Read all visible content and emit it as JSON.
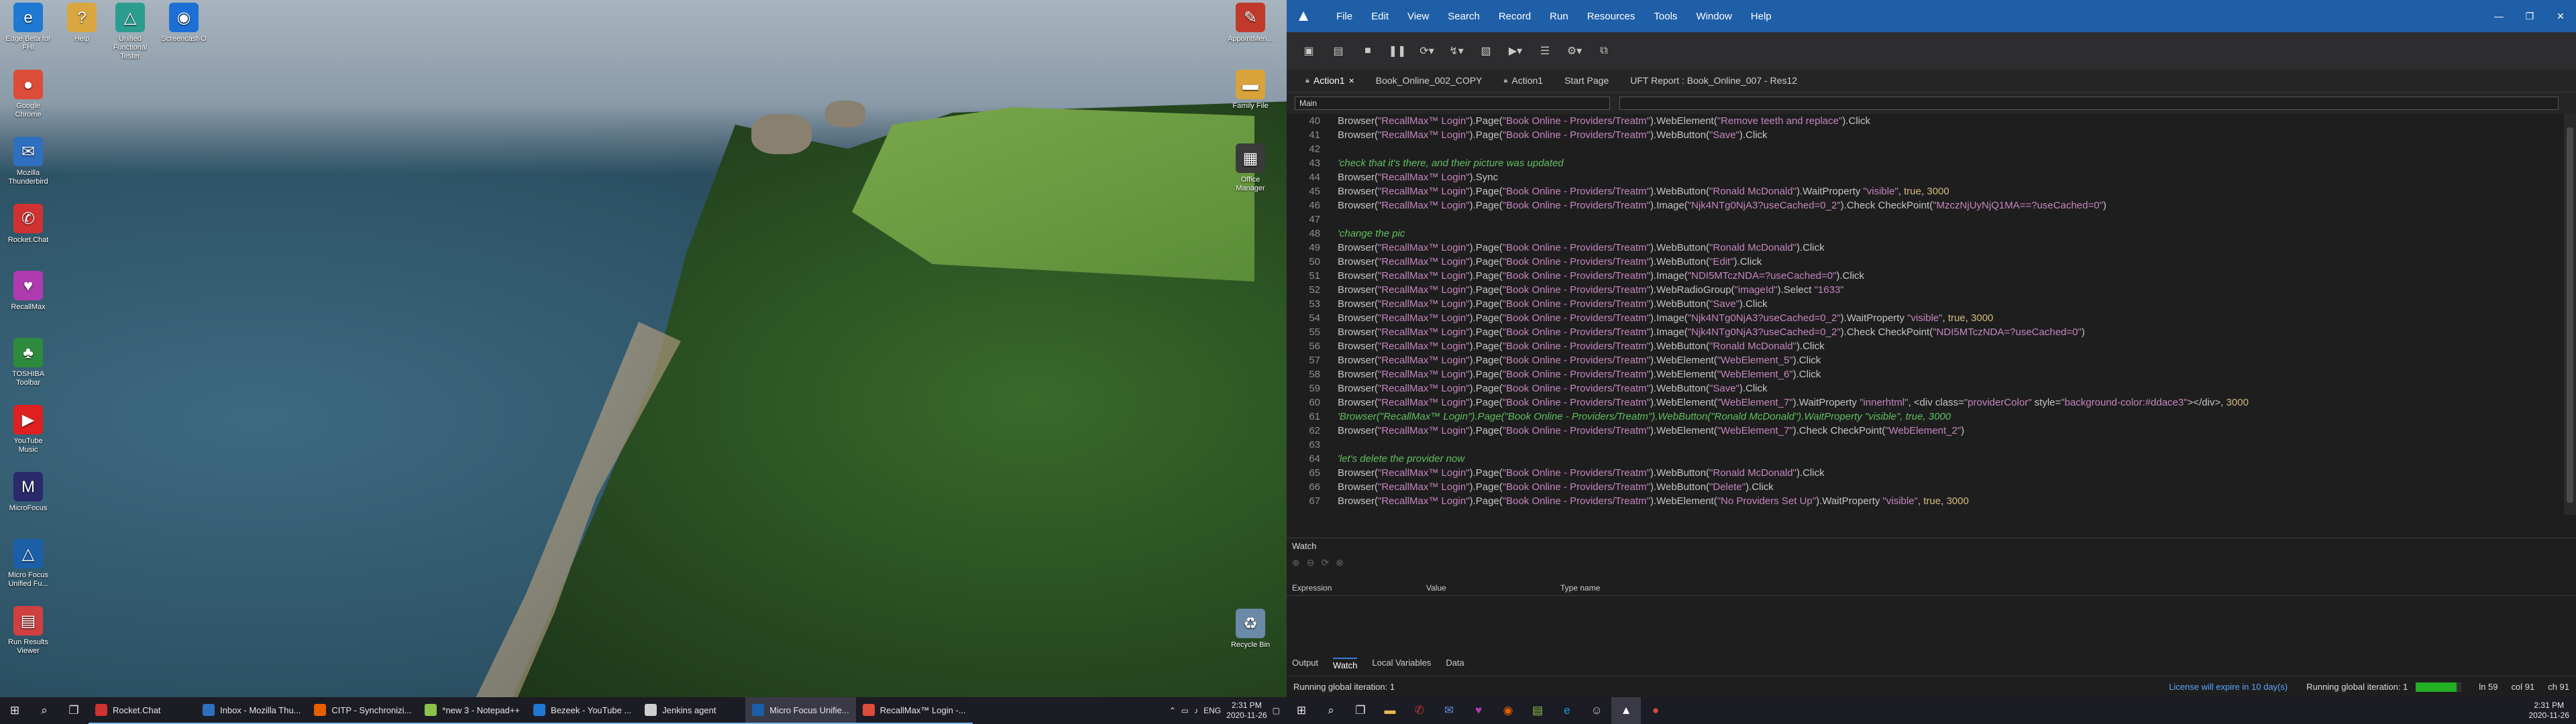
{
  "desktop": {
    "icons_left": [
      {
        "label": "Edge Beta for FHI",
        "color": "#1f78d1",
        "glyph": "e"
      },
      {
        "label": "Help",
        "color": "#d9a640",
        "glyph": "?"
      },
      {
        "label": "Unified Functional Tester",
        "color": "#2a9d8f",
        "glyph": "△"
      },
      {
        "label": "Screencast-O",
        "color": "#1d6fd6",
        "glyph": "◉"
      },
      {
        "label": "Google Chrome",
        "color": "#dd4b39",
        "glyph": "●"
      },
      {
        "label": "Mozilla Thunderbird",
        "color": "#2f6fbf",
        "glyph": "✉"
      },
      {
        "label": "Rocket.Chat",
        "color": "#d03232",
        "glyph": "✆"
      },
      {
        "label": "RecallMax",
        "color": "#b03ab0",
        "glyph": "♥"
      },
      {
        "label": "TOSHIBA Toolbar",
        "color": "#2e8b3e",
        "glyph": "♣"
      },
      {
        "label": "YouTube Music",
        "color": "#e02020",
        "glyph": "▶"
      },
      {
        "label": "MicroFocus",
        "color": "#2a2a6a",
        "glyph": "M"
      },
      {
        "label": "Micro Focus Unified Fu...",
        "color": "#1b5fa8",
        "glyph": "△"
      },
      {
        "label": "Run Results Viewer",
        "color": "#d04040",
        "glyph": "▤"
      }
    ],
    "icons_right": [
      {
        "label": "AppointMen...",
        "color": "#c0392b",
        "glyph": "✎"
      },
      {
        "label": "Family File",
        "color": "#d8a33a",
        "glyph": "▬"
      },
      {
        "label": "Office Manager",
        "color": "#3a3a3a",
        "glyph": "▦"
      },
      {
        "label": "Recycle Bin",
        "color": "#6a8aa8",
        "glyph": "♻"
      }
    ]
  },
  "uft": {
    "menu": [
      "File",
      "Edit",
      "View",
      "Search",
      "Record",
      "Run",
      "Resources",
      "Tools",
      "Window",
      "Help"
    ],
    "tabs": [
      {
        "label": "Action1",
        "closable": true,
        "active": true
      },
      {
        "label": "Book_Online_002_COPY",
        "closable": false,
        "active": false
      },
      {
        "label": "Action1",
        "closable": false,
        "active": false
      },
      {
        "label": "Start Page",
        "closable": false,
        "active": false
      },
      {
        "label": "UFT Report : Book_Online_007 - Res12",
        "closable": false,
        "active": false
      }
    ],
    "scope": {
      "left": "Main",
      "right": ""
    },
    "code_lines": [
      {
        "n": "40",
        "type": "code",
        "text": "Browser(\"RecallMax™ Login\").Page(\"Book Online - Providers/Treatm\").WebElement(\"Remove teeth and replace\").Click"
      },
      {
        "n": "41",
        "type": "code",
        "text": "Browser(\"RecallMax™ Login\").Page(\"Book Online - Providers/Treatm\").WebButton(\"Save\").Click"
      },
      {
        "n": "42",
        "type": "blank",
        "text": ""
      },
      {
        "n": "43",
        "type": "comment",
        "text": "'check that it's there, and their picture was updated"
      },
      {
        "n": "44",
        "type": "code",
        "text": "Browser(\"RecallMax™ Login\").Sync"
      },
      {
        "n": "45",
        "type": "code",
        "text": "Browser(\"RecallMax™ Login\").Page(\"Book Online - Providers/Treatm\").WebButton(\"Ronald McDonald\").WaitProperty \"visible\", true, 3000"
      },
      {
        "n": "46",
        "type": "code",
        "text": "Browser(\"RecallMax™ Login\").Page(\"Book Online - Providers/Treatm\").Image(\"Njk4NTg0NjA3?useCached=0_2\").Check CheckPoint(\"MzczNjUyNjQ1MA==?useCached=0\")"
      },
      {
        "n": "47",
        "type": "blank",
        "text": ""
      },
      {
        "n": "48",
        "type": "comment",
        "text": "'change the pic"
      },
      {
        "n": "49",
        "type": "code",
        "text": "Browser(\"RecallMax™ Login\").Page(\"Book Online - Providers/Treatm\").WebButton(\"Ronald McDonald\").Click"
      },
      {
        "n": "50",
        "type": "code",
        "text": "Browser(\"RecallMax™ Login\").Page(\"Book Online - Providers/Treatm\").WebButton(\"Edit\").Click"
      },
      {
        "n": "51",
        "type": "code",
        "text": "Browser(\"RecallMax™ Login\").Page(\"Book Online - Providers/Treatm\").Image(\"NDI5MTczNDA=?useCached=0\").Click"
      },
      {
        "n": "52",
        "type": "code",
        "text": "Browser(\"RecallMax™ Login\").Page(\"Book Online - Providers/Treatm\").WebRadioGroup(\"imageId\").Select \"1633\""
      },
      {
        "n": "53",
        "type": "code",
        "text": "Browser(\"RecallMax™ Login\").Page(\"Book Online - Providers/Treatm\").WebButton(\"Save\").Click"
      },
      {
        "n": "54",
        "type": "code",
        "text": "Browser(\"RecallMax™ Login\").Page(\"Book Online - Providers/Treatm\").Image(\"Njk4NTg0NjA3?useCached=0_2\").WaitProperty \"visible\", true, 3000"
      },
      {
        "n": "55",
        "type": "code",
        "text": "Browser(\"RecallMax™ Login\").Page(\"Book Online - Providers/Treatm\").Image(\"Njk4NTg0NjA3?useCached=0_2\").Check CheckPoint(\"NDI5MTczNDA=?useCached=0\")"
      },
      {
        "n": "56",
        "type": "code",
        "text": "Browser(\"RecallMax™ Login\").Page(\"Book Online - Providers/Treatm\").WebButton(\"Ronald McDonald\").Click"
      },
      {
        "n": "57",
        "type": "code",
        "text": "Browser(\"RecallMax™ Login\").Page(\"Book Online - Providers/Treatm\").WebElement(\"WebElement_5\").Click"
      },
      {
        "n": "58",
        "type": "code",
        "text": "Browser(\"RecallMax™ Login\").Page(\"Book Online - Providers/Treatm\").WebElement(\"WebElement_6\").Click"
      },
      {
        "n": "59",
        "type": "code",
        "text": "Browser(\"RecallMax™ Login\").Page(\"Book Online - Providers/Treatm\").WebButton(\"Save\").Click"
      },
      {
        "n": "60",
        "type": "code",
        "text": "Browser(\"RecallMax™ Login\").Page(\"Book Online - Providers/Treatm\").WebElement(\"WebElement_7\").WaitProperty \"innerhtml\", <div class=\"providerColor\" style=\"background-color:#ddace3\"></div>, 3000"
      },
      {
        "n": "61",
        "type": "comment",
        "text": "'Browser(\"RecallMax™ Login\").Page(\"Book Online - Providers/Treatm\").WebButton(\"Ronald McDonald\").WaitProperty \"visible\", true, 3000"
      },
      {
        "n": "62",
        "type": "code",
        "text": "Browser(\"RecallMax™ Login\").Page(\"Book Online - Providers/Treatm\").WebElement(\"WebElement_7\").Check CheckPoint(\"WebElement_2\")"
      },
      {
        "n": "63",
        "type": "blank",
        "text": ""
      },
      {
        "n": "64",
        "type": "comment",
        "text": "'let's delete the provider now"
      },
      {
        "n": "65",
        "type": "code",
        "text": "Browser(\"RecallMax™ Login\").Page(\"Book Online - Providers/Treatm\").WebButton(\"Ronald McDonald\").Click"
      },
      {
        "n": "66",
        "type": "code",
        "text": "Browser(\"RecallMax™ Login\").Page(\"Book Online - Providers/Treatm\").WebButton(\"Delete\").Click"
      },
      {
        "n": "67",
        "type": "code",
        "text": "Browser(\"RecallMax™ Login\").Page(\"Book Online - Providers/Treatm\").WebElement(\"No Providers Set Up\").WaitProperty \"visible\", true, 3000"
      }
    ],
    "watch": {
      "title": "Watch",
      "columns": [
        "Expression",
        "Value",
        "Type name"
      ],
      "panel_tabs": [
        "Output",
        "Watch",
        "Local Variables",
        "Data"
      ],
      "active_tab": "Watch"
    },
    "status": {
      "left": "Running global iteration: 1",
      "license": "License will expire in 10 day(s)",
      "right_iteration": "Running global iteration: 1",
      "progress_fraction": 0.9,
      "line": "ln 59",
      "col": "col 91",
      "ch": "ch 91"
    }
  },
  "taskbar_left": {
    "apps": [
      {
        "label": "Rocket.Chat",
        "color": "#d03232",
        "active": false
      },
      {
        "label": "Inbox - Mozilla Thu...",
        "color": "#2f6fbf",
        "active": false
      },
      {
        "label": "CITP - Synchronizi...",
        "color": "#e66000",
        "active": false
      },
      {
        "label": "*new 3 - Notepad++",
        "color": "#8bc34a",
        "active": false
      },
      {
        "label": "Bezeek - YouTube ...",
        "color": "#1f78d1",
        "active": false
      },
      {
        "label": "Jenkins agent",
        "color": "#cfcfcf",
        "active": false
      },
      {
        "label": "Micro Focus Unifie...",
        "color": "#1b5fa8",
        "active": true
      },
      {
        "label": "RecallMax™ Login -...",
        "color": "#dd4b39",
        "active": false
      }
    ],
    "lang": "ENG",
    "time": "2:31 PM",
    "date": "2020-11-26"
  },
  "taskbar_right": {
    "time": "2:31 PM",
    "date": "2020-11-26"
  }
}
